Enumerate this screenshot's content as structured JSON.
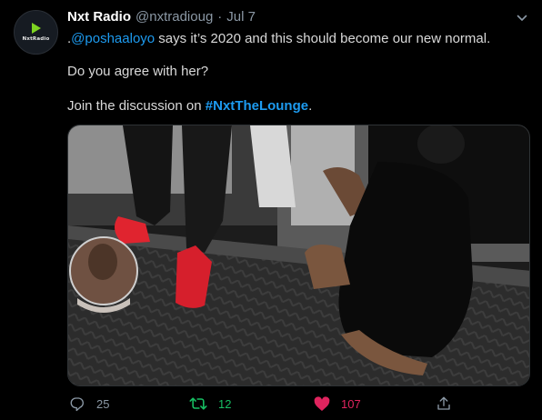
{
  "tweet": {
    "display_name": "Nxt Radio",
    "handle": "@nxtradioug",
    "separator": "·",
    "date": "Jul 7",
    "avatar_label": "NxtRadio",
    "line1_prefix": ".",
    "line1_mention": "@poshaaloyo",
    "line1_rest": " says it’s 2020 and this should become our new normal.",
    "line2": "Do you agree with her?",
    "line3_prefix": "Join the discussion on ",
    "line3_hashtag": "#NxtTheLounge",
    "line3_suffix": "."
  },
  "actions": {
    "reply_count": "25",
    "retweet_count": "12",
    "like_count": "107",
    "reply_icon": "reply-icon",
    "retweet_icon": "retweet-icon",
    "like_icon": "heart-icon",
    "share_icon": "share-icon"
  },
  "colors": {
    "background": "#000000",
    "link": "#1d9bf0",
    "retweet_active": "#17bf63",
    "like_active": "#e0245e",
    "muted": "#8b98a5"
  }
}
